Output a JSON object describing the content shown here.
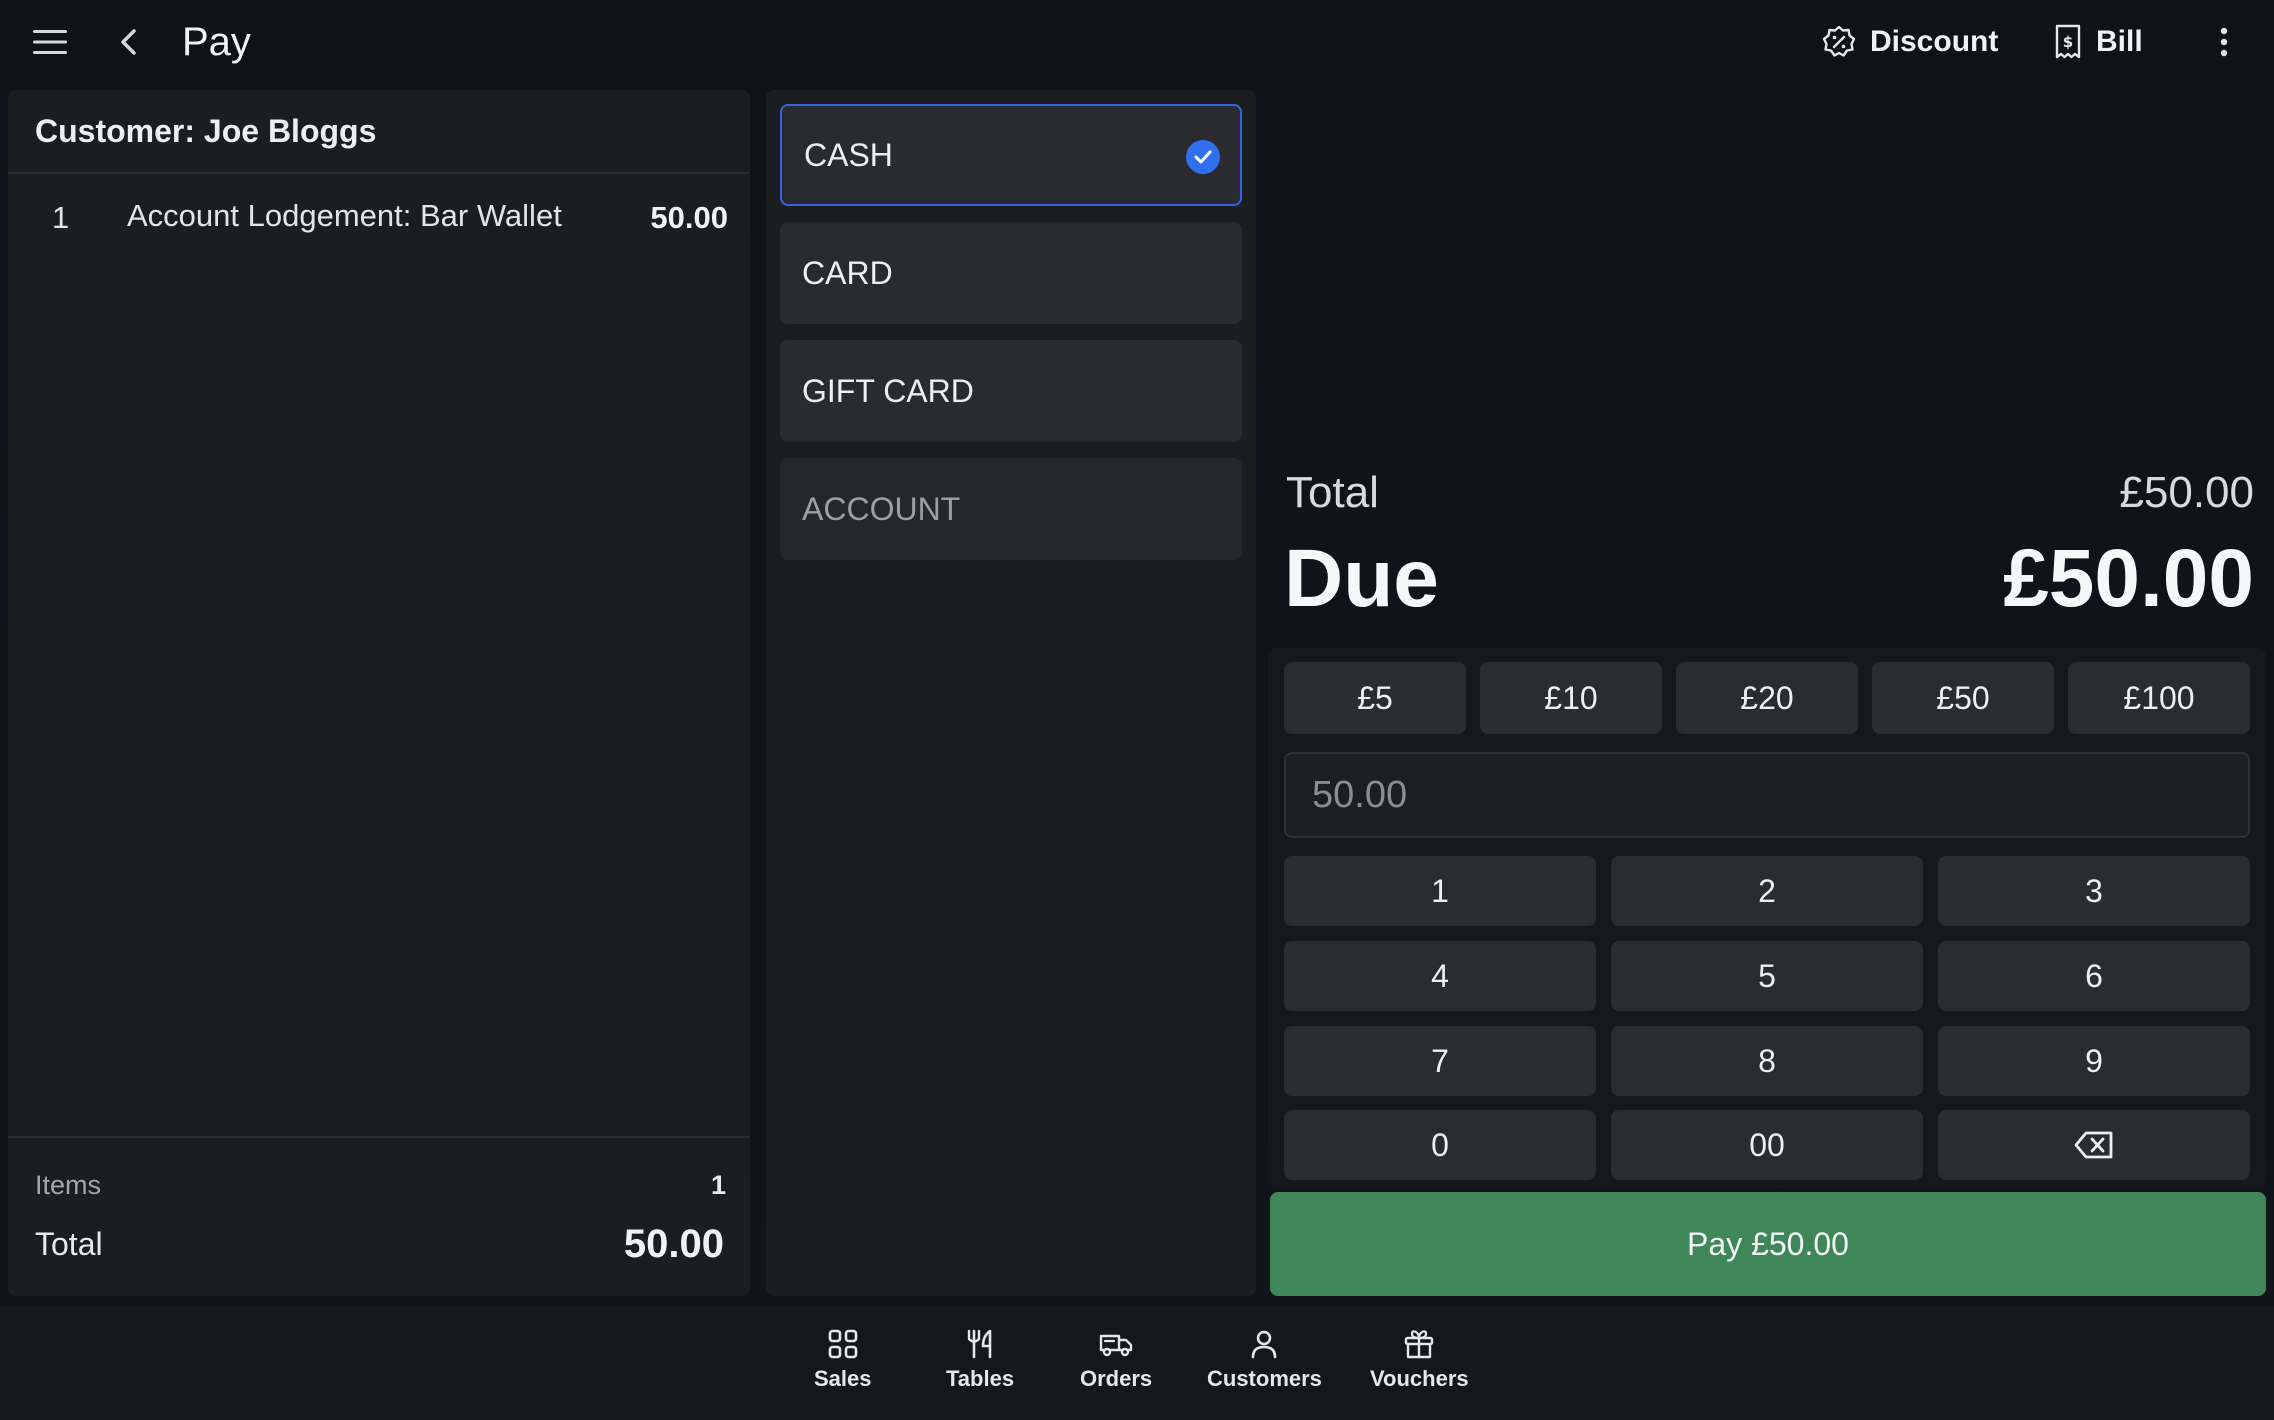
{
  "header": {
    "title": "Pay",
    "discount_label": "Discount",
    "bill_label": "Bill"
  },
  "order": {
    "customer_heading": "Customer: Joe Bloggs",
    "lines": [
      {
        "qty": "1",
        "description": "Account Lodgement: Bar Wallet",
        "price": "50.00"
      }
    ],
    "items_label": "Items",
    "items_count": "1",
    "total_label": "Total",
    "total_value": "50.00"
  },
  "payment_methods": [
    {
      "label": "CASH",
      "selected": true
    },
    {
      "label": "CARD",
      "selected": false
    },
    {
      "label": "GIFT CARD",
      "selected": false
    },
    {
      "label": "ACCOUNT",
      "selected": false
    }
  ],
  "summary": {
    "total_label": "Total",
    "total_value": "£50.00",
    "due_label": "Due",
    "due_value": "£50.00"
  },
  "quick_amounts": [
    "£5",
    "£10",
    "£20",
    "£50",
    "£100"
  ],
  "amount_input": {
    "placeholder": "50.00"
  },
  "keypad": [
    "1",
    "2",
    "3",
    "4",
    "5",
    "6",
    "7",
    "8",
    "9",
    "0",
    "00"
  ],
  "pay_button_label": "Pay £50.00",
  "bottom_nav": [
    {
      "label": "Sales",
      "icon": "grid-icon"
    },
    {
      "label": "Tables",
      "icon": "cutlery-icon"
    },
    {
      "label": "Orders",
      "icon": "delivery-truck-icon"
    },
    {
      "label": "Customers",
      "icon": "user-icon"
    },
    {
      "label": "Vouchers",
      "icon": "gift-icon"
    }
  ],
  "colors": {
    "accent_blue": "#2f6ff0",
    "pay_green": "#3f8658",
    "background": "#111419",
    "panel": "#1c1d21"
  }
}
